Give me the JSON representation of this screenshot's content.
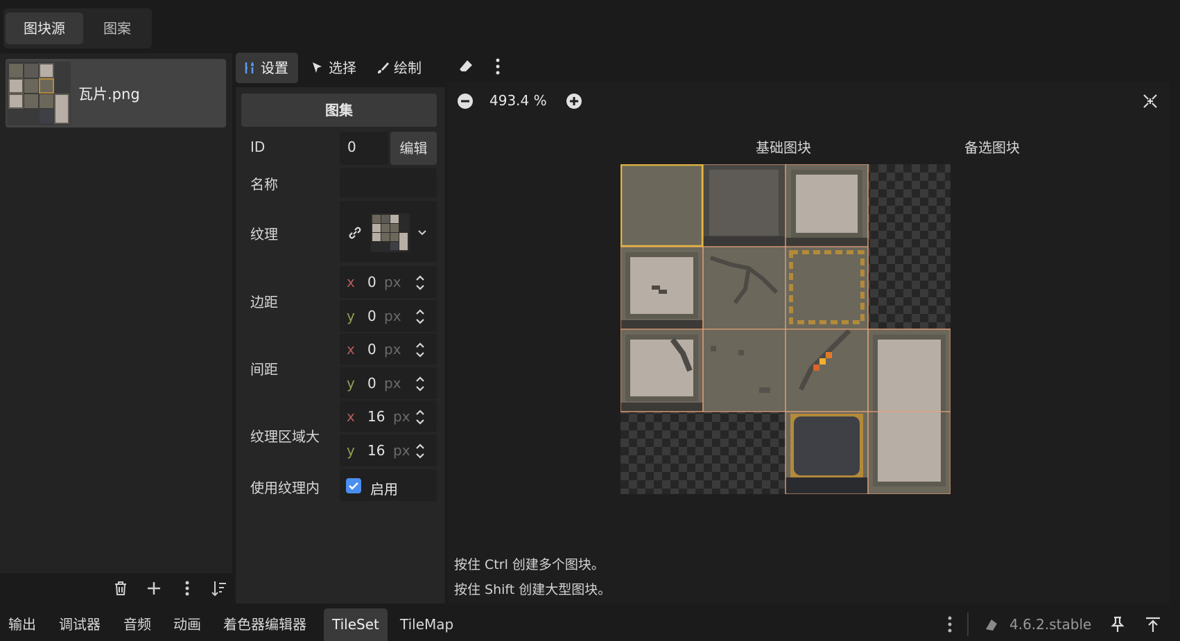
{
  "top_tabs": [
    "图块源",
    "图案"
  ],
  "source": {
    "label": "瓦片.png"
  },
  "toolbar": {
    "settings": "设置",
    "select": "选择",
    "draw": "绘制"
  },
  "settings": {
    "header": "图集",
    "id_label": "ID",
    "id_value": "0",
    "edit_button": "编辑",
    "name_label": "名称",
    "name_value": "",
    "texture_label": "纹理",
    "margins_label": "边距",
    "margins": {
      "x": "0",
      "y": "0"
    },
    "separation_label": "间距",
    "separation": {
      "x": "0",
      "y": "0"
    },
    "region_label": "纹理区域大",
    "region": {
      "x": "16",
      "y": "16"
    },
    "use_texture_label": "使用纹理内",
    "use_texture_value": "启用",
    "use_texture_checked": true,
    "unit": "px",
    "axis_x": "x",
    "axis_y": "y"
  },
  "atlas": {
    "zoom": "493.4 %",
    "label_base": "基础图块",
    "label_alternative": "备选图块",
    "hint_ctrl": "按住 Ctrl 创建多个图块。",
    "hint_shift": "按住 Shift 创建大型图块。"
  },
  "bottom_dock": {
    "tabs": [
      "输出",
      "调试器",
      "音频",
      "动画",
      "着色器编辑器",
      "TileSet",
      "TileMap"
    ],
    "active": "TileSet",
    "version": "4.6.2.stable"
  },
  "colors": {
    "accent": "#4a8ef0",
    "tile_highlight": "#e3b341",
    "tile_border": "#e8a27a",
    "axis_x": "#b85c5c",
    "axis_y": "#8ea356"
  }
}
